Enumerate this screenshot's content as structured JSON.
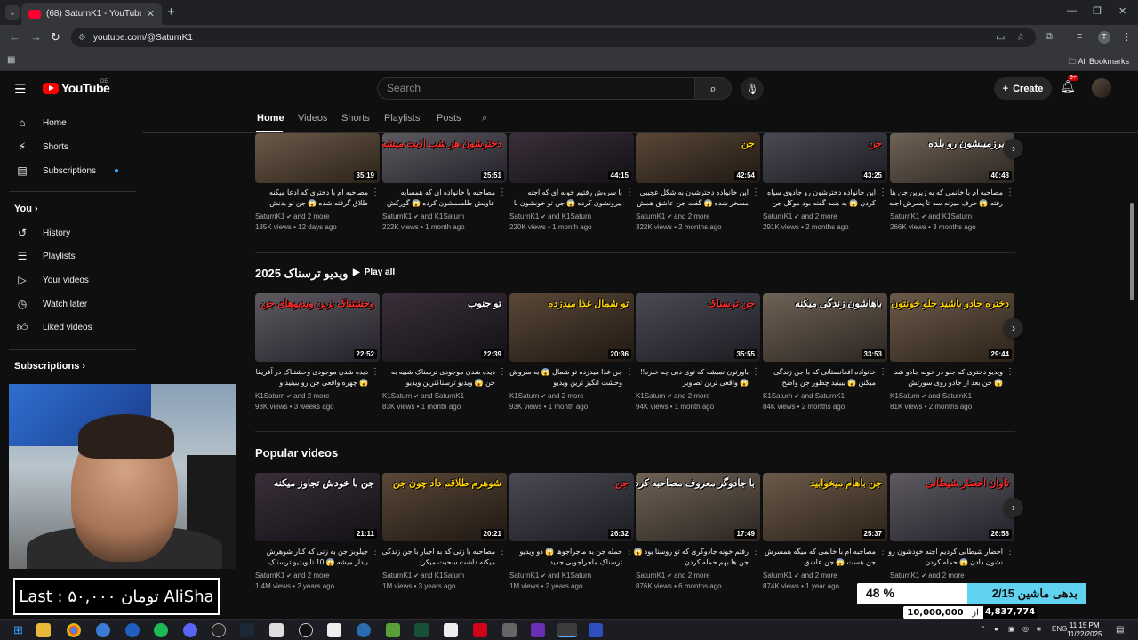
{
  "browser": {
    "tab_title": "(68) SaturnK1 - YouTube",
    "url": "youtube.com/@SaturnK1",
    "all_bookmarks": "All Bookmarks",
    "profile_initial": "T"
  },
  "youtube": {
    "logo": "YouTube",
    "country": "DE",
    "search_placeholder": "Search",
    "create_label": "Create",
    "notifications": "9+"
  },
  "sidebar": {
    "items": [
      {
        "label": "Home",
        "icon": "home-icon"
      },
      {
        "label": "Shorts",
        "icon": "shorts-icon"
      },
      {
        "label": "Subscriptions",
        "icon": "subscriptions-icon"
      }
    ],
    "you_label": "You",
    "you_items": [
      {
        "label": "History"
      },
      {
        "label": "Playlists"
      },
      {
        "label": "Your videos"
      },
      {
        "label": "Watch later"
      },
      {
        "label": "Liked videos"
      }
    ],
    "subscriptions_label": "Subscriptions"
  },
  "channel_tabs": [
    "Home",
    "Videos",
    "Shorts",
    "Playlists",
    "Posts"
  ],
  "row1": [
    {
      "duration": "35:19",
      "title": "مصاحبه ام با دختری که ادعا میکنه طلاق گرفته شده 😱 جن تو بدنش بهمون گفت",
      "channel": "SaturnK1",
      "also": "and 2 more",
      "stats": "185K views • 12 days ago",
      "overlay": ""
    },
    {
      "duration": "25:51",
      "title": "مصاحبه با خانواده ای که همسایه عاویش طلسمشون کرده 😱 گورکش",
      "channel": "SaturnK1",
      "also": "and K1Saturn",
      "stats": "222K views • 1 month ago",
      "overlay": "دخترشون هر شب اذیت میشه"
    },
    {
      "duration": "44:15",
      "title": "با سروش رفتیم خونه ای که اجنه بیرونشون کرده 😱 جن تو خونشون با همه",
      "channel": "SaturnK1",
      "also": "and K1Saturn",
      "stats": "220K views • 1 month ago",
      "overlay": ""
    },
    {
      "duration": "42:54",
      "title": "این خانواده دخترشون به شکل عجیبی مسخر شده 😱 گفت جن عاشق همش",
      "channel": "SaturnK1",
      "also": "and 2 more",
      "stats": "322K views • 2 months ago",
      "overlay": "جن"
    },
    {
      "duration": "43:25",
      "title": "این خانواده دخترشون رو جادوی سیاه کردن 😱 به همه گفته بود موکل جن داره",
      "channel": "SaturnK1",
      "also": "and 2 more",
      "stats": "291K views • 2 months ago",
      "overlay": "جن"
    },
    {
      "duration": "40:48",
      "title": "مصاحبه ام با خانمی که به زیرین جن ها رفته 😱 حرف میزنه سه تا پسرش اجنه رو",
      "channel": "SaturnK1",
      "also": "and K1Saturn",
      "stats": "266K views • 3 months ago",
      "overlay": "زیرزمینشون رو بلده"
    }
  ],
  "row2": {
    "title": "ویدیو ترسناک 2025",
    "play_all": "Play all",
    "videos": [
      {
        "duration": "22:52",
        "title": "دیده شدن موجودی وحشتناک در آفریقا 😱 چهره واقعی جن رو ببینید و",
        "channel": "K1Saturn",
        "also": "and 2 more",
        "stats": "98K views • 3 weeks ago",
        "overlay": "وحشتناک ترین ویدیوهای جن"
      },
      {
        "duration": "22:39",
        "title": "دیده شدن موجودی ترسناک شبیه به جن 😱 ویدیو ترسناکترین ویدیو",
        "channel": "K1Saturn",
        "also": "and SaturnK1",
        "stats": "83K views • 1 month ago",
        "overlay": "تو جنوب"
      },
      {
        "duration": "20:36",
        "title": "جن غذا میدزده تو شمال 😱 به سروش وحشت انگیز ترین ویدیو",
        "channel": "K1Saturn",
        "also": "and 2 more",
        "stats": "93K views • 1 month ago",
        "overlay": "تو شمال غذا میدزده"
      },
      {
        "duration": "35:55",
        "title": "باورتون نمیشه که توی دبی چه خبره!! 😱 واقعی ترین تصاویر",
        "channel": "K1Saturn",
        "also": "and 2 more",
        "stats": "94K views • 1 month ago",
        "overlay": "جن ترسناک"
      },
      {
        "duration": "33:53",
        "title": "خانواده افغانستانی که با جن زندگی میکنن 😱 ببینید چطور جن واضح",
        "channel": "K1Saturn",
        "also": "and SaturnK1",
        "stats": "84K views • 2 months ago",
        "overlay": "باهاشون زندگی میکنه"
      },
      {
        "duration": "29:44",
        "title": "ویدیو دختری که جلو در خونه جادو شد 😱 جن بعد از جادو روی سورتش",
        "channel": "K1Saturn",
        "also": "and SaturnK1",
        "stats": "81K views • 2 months ago",
        "overlay": "دختره جادو باشید جلو خونتون"
      }
    ]
  },
  "row3": {
    "title": "Popular videos",
    "videos": [
      {
        "duration": "21:11",
        "title": "جیلوبز جن به زنی که کنار شوهرش بیدار میشه 😱 10 تا ویدیو ترسناک",
        "channel": "SaturnK1",
        "also": "and 2 more",
        "stats": "1.4M views • 2 years ago",
        "overlay": "جن با خودش تجاوز میکنه"
      },
      {
        "duration": "20:21",
        "title": "مصاحبه با زنی که به اجبار با جن زندگی میکنه داشت سحبت میکرد",
        "channel": "SaturnK1",
        "also": "and K1Saturn",
        "stats": "1M views • 3 years ago",
        "overlay": "شوهرم طلاقم داد چون جن"
      },
      {
        "duration": "26:32",
        "title": "حمله جن به ماجراجوها 😱 دو ویدیو ترسناک ماجراجویی جدید",
        "channel": "SaturnK1",
        "also": "and K1Saturn",
        "stats": "1M views • 2 years ago",
        "overlay": "جن"
      },
      {
        "duration": "17:49",
        "title": "رفتم خونه جادوگری که تو روستا بود 😱 جن ها بهم حمله کردن",
        "channel": "SaturnK1",
        "also": "and 2 more",
        "stats": "876K views • 6 months ago",
        "overlay": "با جادوگر معروف مصاحبه کردم"
      },
      {
        "duration": "25:37",
        "title": "مصاحبه ام با خانمی که میگه همسرش جن هست 😱 جن عاشق",
        "channel": "SaturnK1",
        "also": "and 2 more",
        "stats": "874K views • 1 year ago",
        "overlay": "جن باهام میخوابید"
      },
      {
        "duration": "26:58",
        "title": "احضار شیطانی کردیم اجنه خودشون رو نشون دادن 😱 حمله کردن",
        "channel": "SaturnK1",
        "also": "and 2 more",
        "stats": "",
        "overlay": "تاوان احضار شیطانی"
      }
    ]
  },
  "overlays": {
    "donation": "Last : ۵۰,۰۰۰ تومان AliSha",
    "goal_percent": 48,
    "goal_percent_text": "48 %",
    "goal_label": "بدهی ماشین 2/15",
    "goal_current": "4,837,774",
    "goal_separator": "از",
    "goal_total": "10,000,000"
  },
  "taskbar": {
    "time": "11:15 PM",
    "date": "11/22/2025",
    "lang": "ENG"
  }
}
